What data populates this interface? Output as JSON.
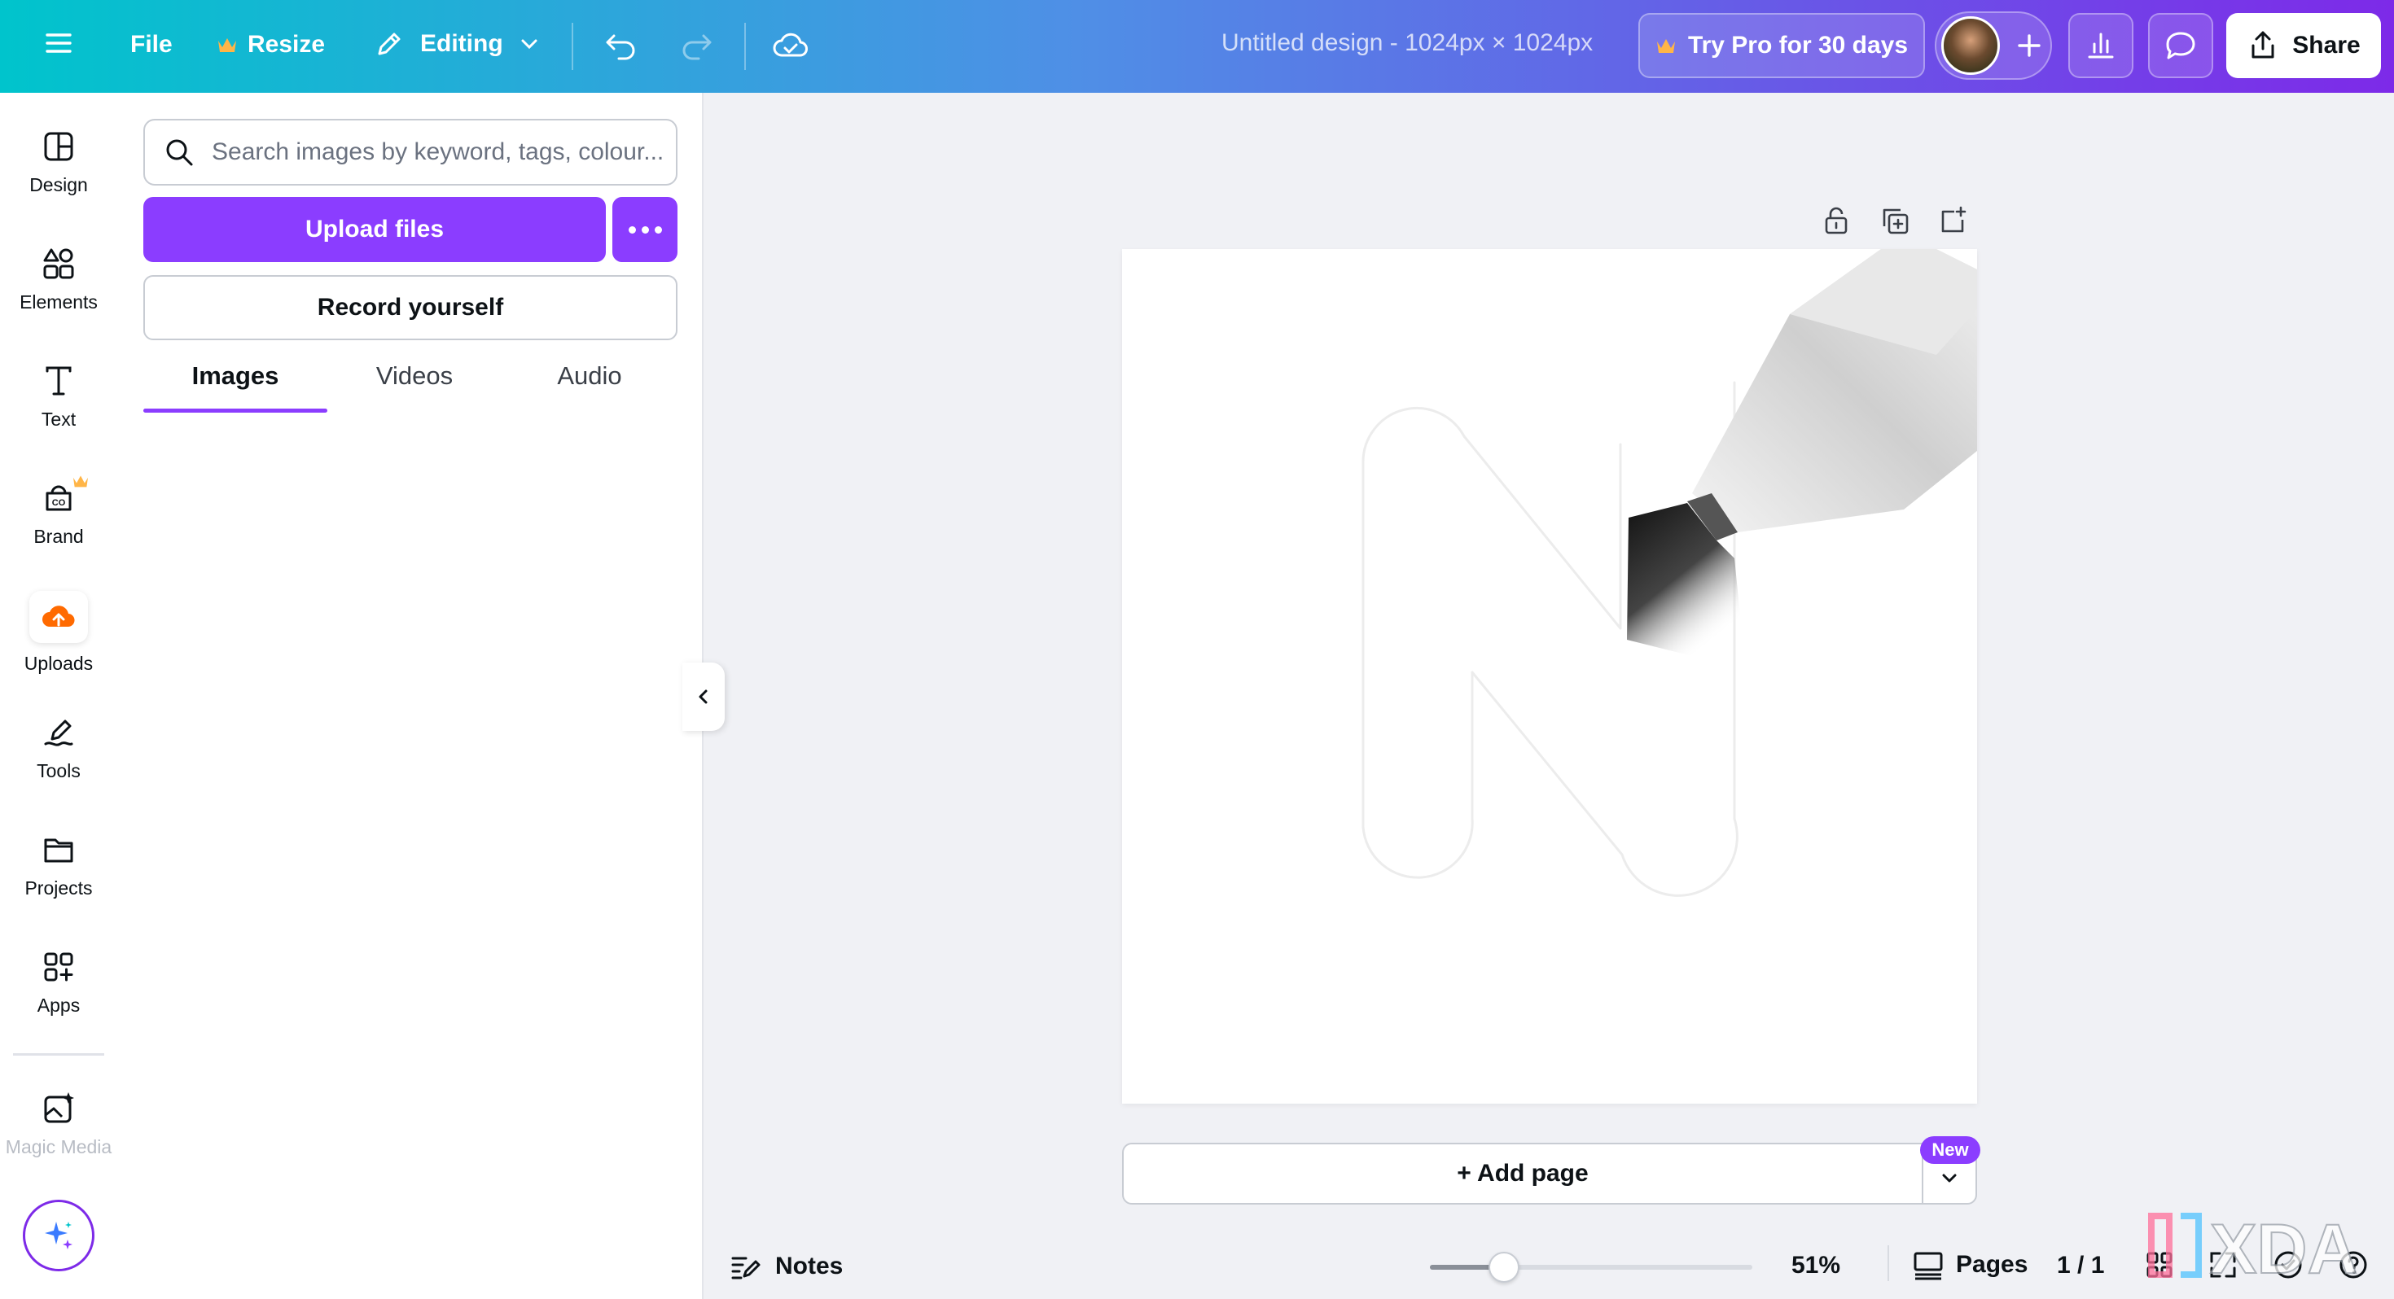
{
  "topbar": {
    "menu_icon": "hamburger-menu-icon",
    "file_label": "File",
    "resize_label": "Resize",
    "editing_label": "Editing",
    "doc_title": "Untitled design - 1024px × 1024px",
    "pro_label": "Try Pro for 30 days",
    "share_label": "Share",
    "colors": {
      "gradient_start": "#00c4cc",
      "gradient_end": "#7d2ae8",
      "crown": "#ffb547"
    }
  },
  "leftnav": {
    "items": [
      {
        "label": "Design",
        "icon": "design-icon"
      },
      {
        "label": "Elements",
        "icon": "elements-icon"
      },
      {
        "label": "Text",
        "icon": "text-icon"
      },
      {
        "label": "Brand",
        "icon": "brand-icon"
      },
      {
        "label": "Uploads",
        "icon": "uploads-icon"
      },
      {
        "label": "Tools",
        "icon": "tools-icon"
      },
      {
        "label": "Projects",
        "icon": "projects-icon"
      },
      {
        "label": "Apps",
        "icon": "apps-icon"
      },
      {
        "label": "Magic Media",
        "icon": "magic-media-icon"
      }
    ],
    "active": "Uploads",
    "accent": "#ff6a00"
  },
  "panel": {
    "search_placeholder": "Search images by keyword, tags, colour...",
    "upload_label": "Upload files",
    "record_label": "Record yourself",
    "tabs": [
      {
        "label": "Images"
      },
      {
        "label": "Videos"
      },
      {
        "label": "Audio"
      }
    ],
    "active_tab": "Images",
    "primary_color": "#8b3dff"
  },
  "canvas": {
    "add_page_label": "+ Add page",
    "new_badge": "New"
  },
  "bottombar": {
    "notes_label": "Notes",
    "zoom_value": "51%",
    "zoom_fraction": 0.23,
    "pages_label": "Pages",
    "page_count": "1 / 1"
  },
  "watermark": {
    "text": "XDA"
  }
}
